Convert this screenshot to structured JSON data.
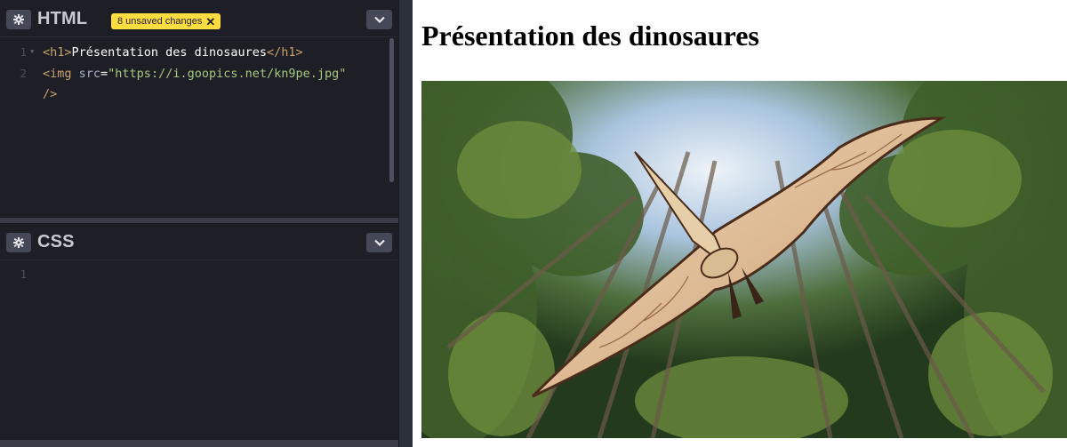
{
  "html_panel": {
    "title": "HTML",
    "badge": "8 unsaved changes",
    "line_numbers": [
      "1",
      "2"
    ],
    "code": {
      "line1_open": "<h1>",
      "line1_text": "Présentation des dinosaures",
      "line1_close": "</h1>",
      "line2_tag": "<img",
      "line2_attr": " src",
      "line2_eq": "=",
      "line2_value": "\"https://i.goopics.net/kn9pe.jpg\"",
      "line3_close": "/>"
    }
  },
  "css_panel": {
    "title": "CSS",
    "line_numbers": [
      "1"
    ]
  },
  "preview": {
    "heading": "Présentation des dinosaures",
    "image_alt": "pterosaur-flying-over-forest-photo"
  },
  "colors": {
    "editor_bg": "#1e1f26",
    "badge": "#ffdd40",
    "tag": "#c9a26d",
    "string": "#a5c87e"
  },
  "icons": [
    "gear-icon",
    "chevron-down-icon",
    "close-icon"
  ]
}
